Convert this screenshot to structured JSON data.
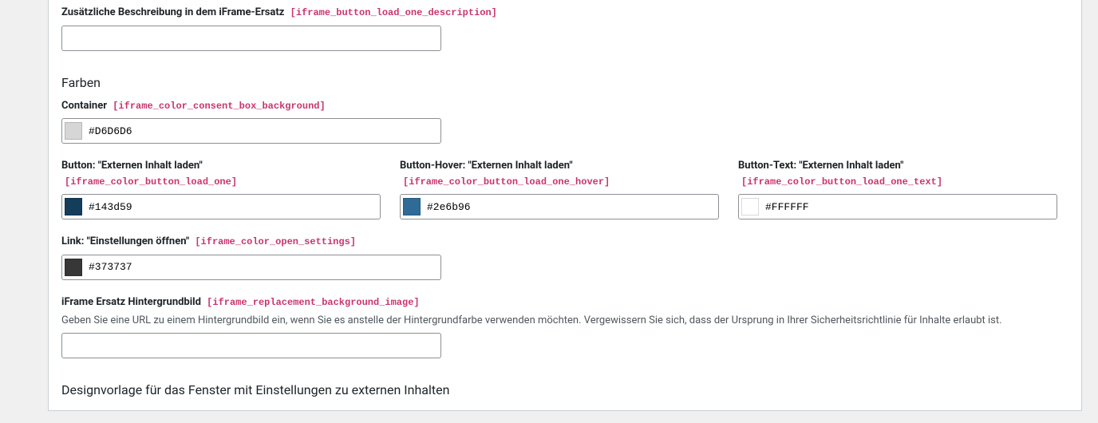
{
  "section1": {
    "desc": {
      "label": "Zusätzliche Beschreibung in dem iFrame-Ersatz",
      "key": "[iframe_button_load_one_description]",
      "value": ""
    }
  },
  "colors": {
    "title": "Farben",
    "container": {
      "label": "Container",
      "key": "[iframe_color_consent_box_background]",
      "value": "#D6D6D6",
      "swatch": "#D6D6D6"
    },
    "button": {
      "label": "Button: \"Externen Inhalt laden\"",
      "key": "[iframe_color_button_load_one]",
      "value": "#143d59",
      "swatch": "#143d59"
    },
    "button_hover": {
      "label": "Button-Hover: \"Externen Inhalt laden\"",
      "key": "[iframe_color_button_load_one_hover]",
      "value": "#2e6b96",
      "swatch": "#2e6b96"
    },
    "button_text": {
      "label": "Button-Text: \"Externen Inhalt laden\"",
      "key": "[iframe_color_button_load_one_text]",
      "value": "#FFFFFF",
      "swatch": "#FFFFFF"
    },
    "link": {
      "label": "Link: \"Einstellungen öffnen\"",
      "key": "[iframe_color_open_settings]",
      "value": "#373737",
      "swatch": "#373737"
    },
    "bg_image": {
      "label": "iFrame Ersatz Hintergrundbild",
      "key": "[iframe_replacement_background_image]",
      "help": "Geben Sie eine URL zu einem Hintergrundbild ein, wenn Sie es anstelle der Hintergrundfarbe verwenden möchten. Vergewissern Sie sich, dass der Ursprung in Ihrer Sicherheitsrichtlinie für Inhalte erlaubt ist.",
      "value": ""
    }
  },
  "section3": {
    "title": "Designvorlage für das Fenster mit Einstellungen zu externen Inhalten"
  }
}
